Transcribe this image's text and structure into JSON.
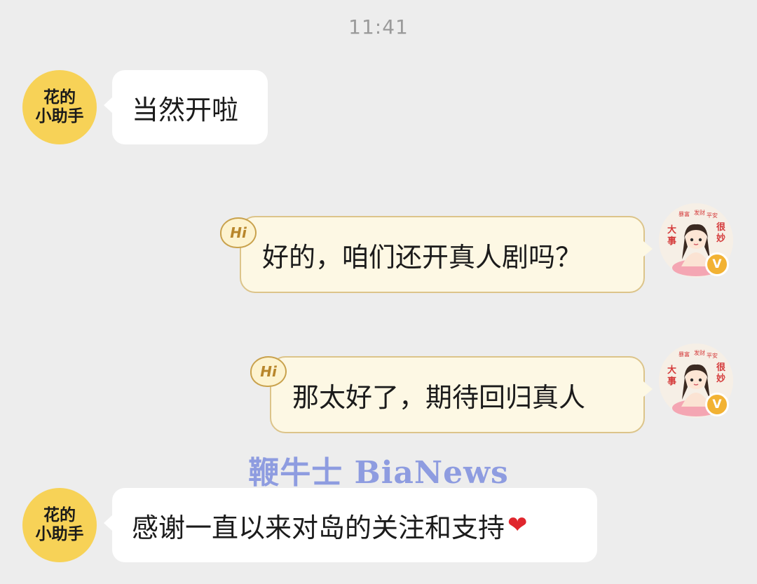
{
  "status": {
    "time": "11:41"
  },
  "bot": {
    "name_line1": "花的",
    "name_line2": "小助手"
  },
  "user": {
    "verified_mark": "V",
    "hi_label": "Hi"
  },
  "messages": [
    {
      "side": "left",
      "text": "当然开啦"
    },
    {
      "side": "right",
      "text": "好的，咱们还开真人剧吗？"
    },
    {
      "side": "right",
      "text": "那太好了，期待回归真人"
    },
    {
      "side": "left",
      "text": "感谢一直以来对岛的关注和支持"
    }
  ],
  "emoji": {
    "heart": "❤"
  },
  "watermark": {
    "text": "鞭牛士 BiaNews"
  },
  "colors": {
    "background": "#ededed",
    "bot_avatar": "#f7d257",
    "user_bubble": "#fdf8e4",
    "user_bubble_border": "#dcc48a",
    "watermark": "#8e9ce0"
  }
}
